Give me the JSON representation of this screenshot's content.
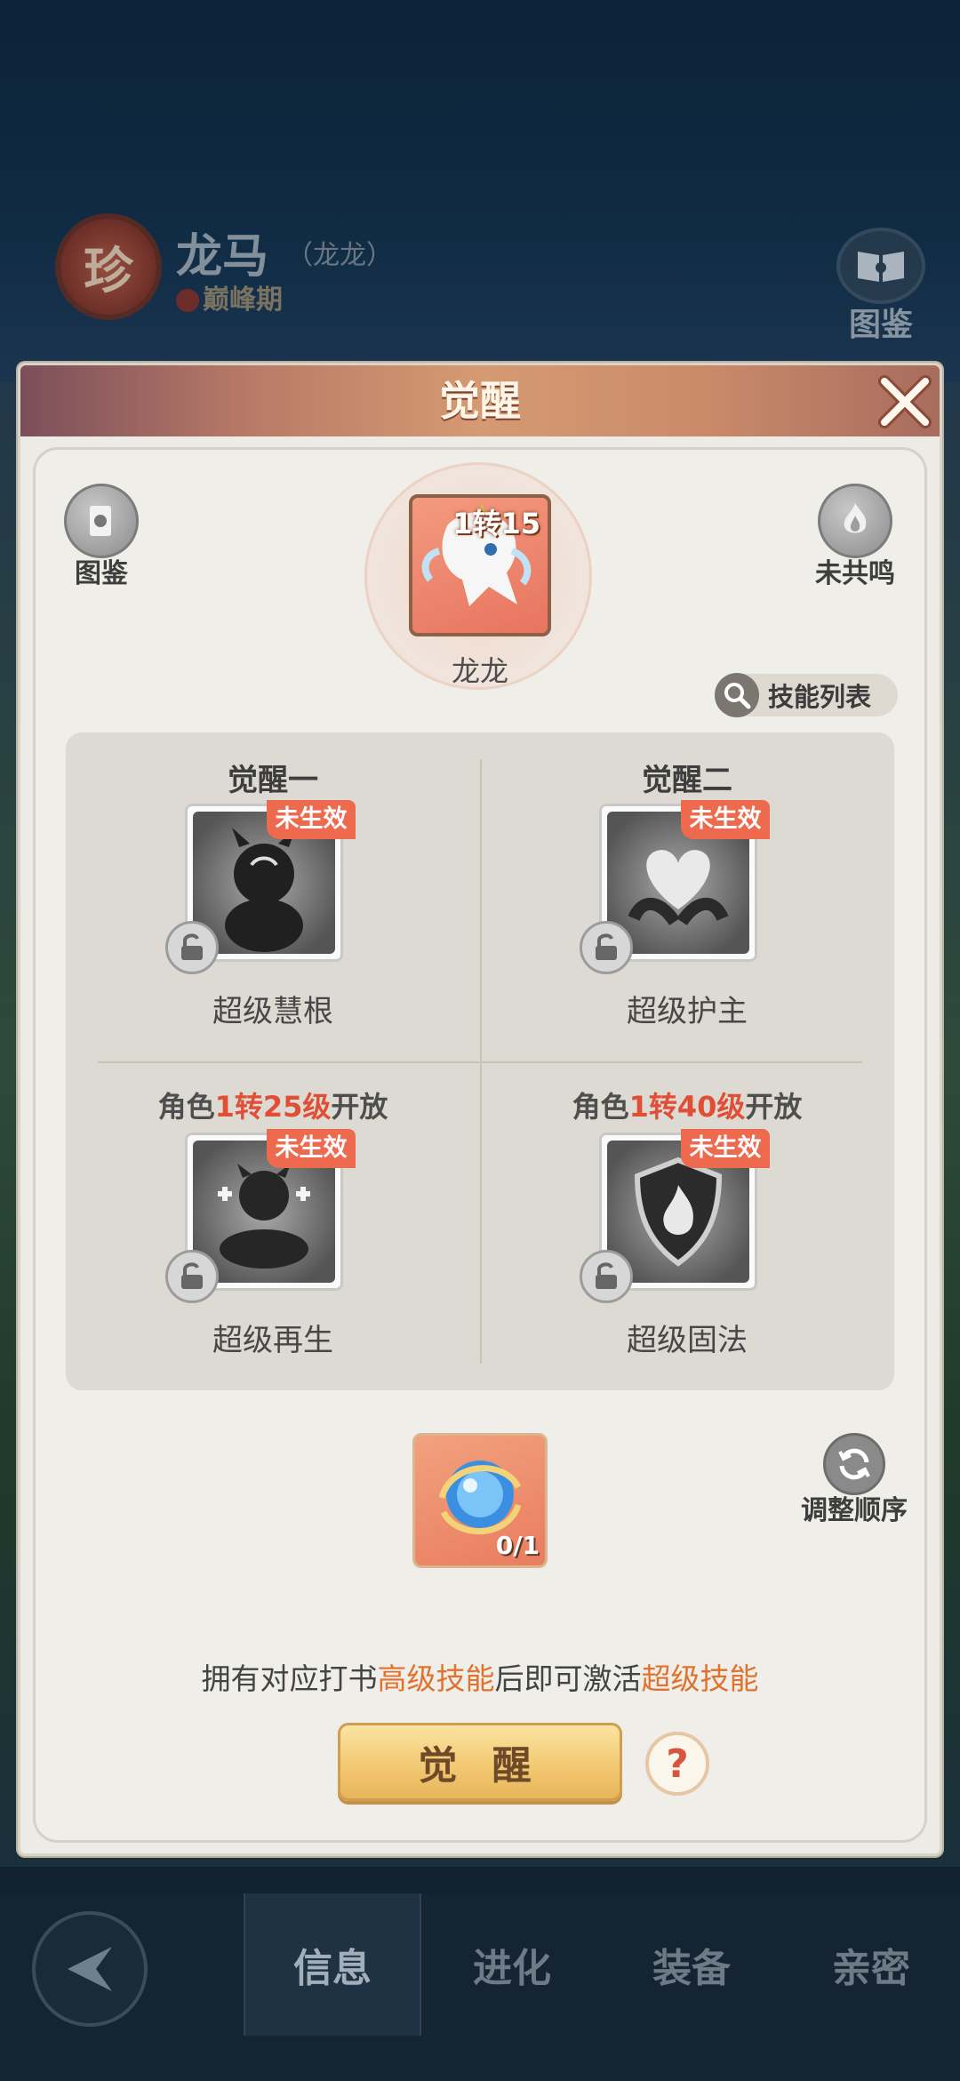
{
  "background": {
    "rarity_badge": "珍",
    "pet_name": "龙马",
    "pet_alias": "（龙龙）",
    "pet_stage": "巅峰期",
    "codex_label": "图鉴",
    "nav_tabs": [
      "信息",
      "进化",
      "装备",
      "亲密"
    ],
    "active_tab": "信息"
  },
  "modal": {
    "title": "觉醒",
    "codex_label": "图鉴",
    "resonance_label": "未共鸣",
    "pet": {
      "level": "1转15",
      "name": "龙龙"
    },
    "skill_list_label": "技能列表",
    "slots": [
      {
        "header": "觉醒一",
        "status": "未生效",
        "skill_name": "超级慧根",
        "icon": "spirit-mind-icon"
      },
      {
        "header": "觉醒二",
        "status": "未生效",
        "skill_name": "超级护主",
        "icon": "heart-hands-icon"
      },
      {
        "header_pre": "角色",
        "header_hl": "1转25级",
        "header_post": "开放",
        "status": "未生效",
        "skill_name": "超级再生",
        "icon": "meditate-heal-icon"
      },
      {
        "header_pre": "角色",
        "header_hl": "1转40级",
        "header_post": "开放",
        "status": "未生效",
        "skill_name": "超级固法",
        "icon": "fire-shield-icon"
      }
    ],
    "item": {
      "count": "0/1",
      "icon": "swirl-orb-icon"
    },
    "reorder_label": "调整顺序",
    "hint": {
      "part1": "拥有对应打书",
      "hl1": "高级技能",
      "part2": "后即可激活",
      "hl2": "超级技能"
    },
    "awaken_button": "觉 醒",
    "help_symbol": "?"
  },
  "colors": {
    "accent_red": "#e04e35",
    "accent_orange": "#e1722e",
    "tag_bg": "#ee6a4f",
    "button_gold": "#f2c770"
  }
}
